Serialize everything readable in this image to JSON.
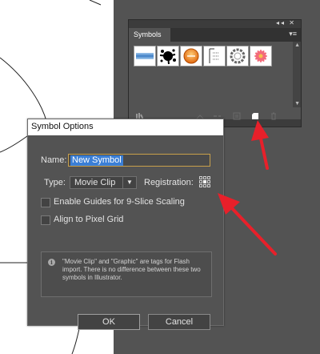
{
  "panel": {
    "tab_label": "Symbols",
    "collapse_icon": "double-chevron-left-icon",
    "close_icon": "close-icon",
    "menu_icon": "panel-menu-icon",
    "swatches": [
      {
        "name": "blue-gradient-bar-symbol"
      },
      {
        "name": "ink-splatter-symbol"
      },
      {
        "name": "orange-button-symbol"
      },
      {
        "name": "map-pin-symbol"
      },
      {
        "name": "gear-ring-symbol"
      },
      {
        "name": "pink-flower-symbol"
      }
    ],
    "footer_buttons": [
      "symbol-libraries-icon",
      "place-symbol-icon",
      "break-link-icon",
      "symbol-options-icon",
      "new-symbol-icon",
      "delete-symbol-icon"
    ]
  },
  "dialog": {
    "title": "Symbol Options",
    "name_label": "Name:",
    "name_value": "New Symbol",
    "type_label": "Type:",
    "type_value": "Movie Clip",
    "registration_label": "Registration:",
    "guides_label": "Enable Guides for 9-Slice Scaling",
    "guides_checked": false,
    "align_label": "Align to Pixel Grid",
    "align_checked": false,
    "info_text": "\"Movie Clip\" and \"Graphic\" are tags for Flash import. There is no difference between these two symbols in Illustrator.",
    "ok_label": "OK",
    "cancel_label": "Cancel"
  },
  "colors": {
    "workspace": "#535353",
    "selection": "#3b7fd6",
    "annotation_arrow": "#e8202a",
    "new_symbol_highlight": "#ffffff"
  }
}
